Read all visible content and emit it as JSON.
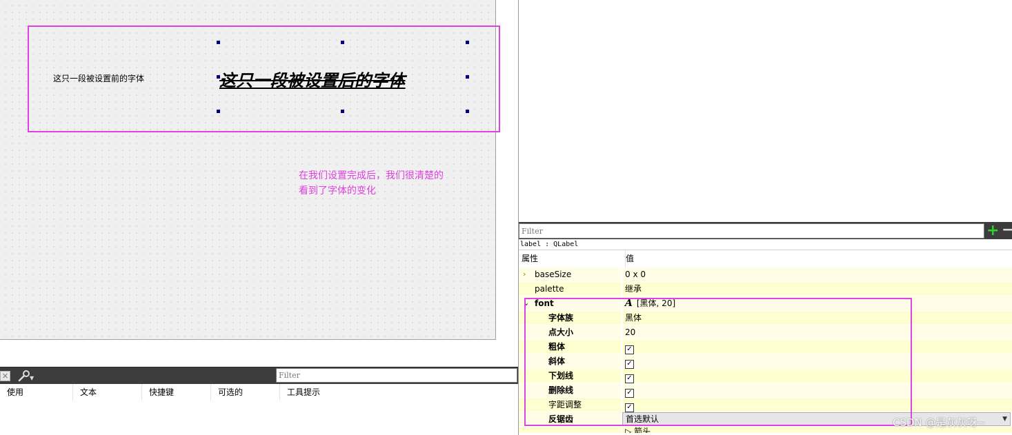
{
  "canvas": {
    "label_before": "这只一段被设置前的字体",
    "label_after": "这只一段被设置后的字体",
    "annotation_line1": "在我们设置完成后，我们很清楚的",
    "annotation_line2": "看到了字体的变化",
    "highlight_color": "#e040e0",
    "handle_color": "#000080"
  },
  "action_editor": {
    "close_icon": "close-icon",
    "wrench_icon": "wrench-icon",
    "filter_placeholder": "Filter",
    "columns": [
      "使用",
      "文本",
      "快捷键",
      "可选的",
      "工具提示"
    ]
  },
  "property_editor": {
    "filter_placeholder": "Filter",
    "add_icon": "+",
    "remove_icon": "−",
    "object_class": "label : QLabel",
    "header_property": "属性",
    "header_value": "值",
    "rows": [
      {
        "name": "baseSize",
        "value": "0 x 0",
        "expander": "›"
      },
      {
        "name": "palette",
        "value": "继承"
      },
      {
        "name": "font",
        "value": "[黑体, 20]",
        "expander": "⌄"
      },
      {
        "name": "字体族",
        "value": "黑体"
      },
      {
        "name": "点大小",
        "value": "20"
      },
      {
        "name": "粗体",
        "value": "✓"
      },
      {
        "name": "斜体",
        "value": "✓"
      },
      {
        "name": "下划线",
        "value": "✓"
      },
      {
        "name": "删除线",
        "value": "✓"
      },
      {
        "name": "字距调整",
        "value": "✓"
      },
      {
        "name": "反锯齿",
        "value": "首选默认"
      }
    ],
    "partial_row_value": "箭头"
  },
  "watermark": "CSDN @是灰灰呀~"
}
